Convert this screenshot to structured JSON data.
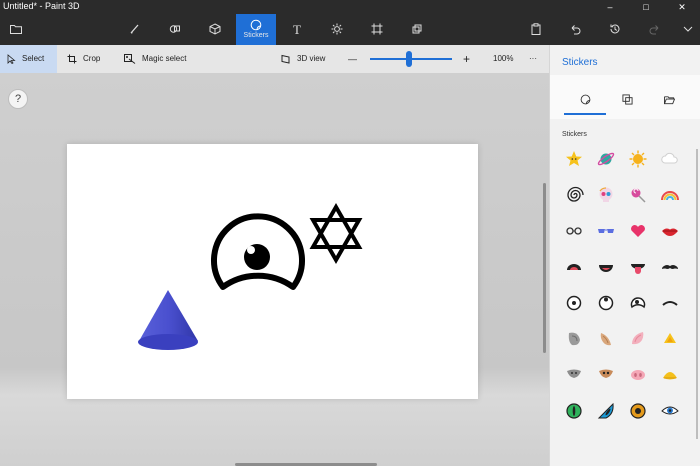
{
  "window": {
    "title": "Untitled* - Paint 3D",
    "controls": [
      "minimize",
      "maximize",
      "close"
    ]
  },
  "ribbon": {
    "tools": [
      {
        "name": "menu",
        "icon": "folder-icon"
      },
      {
        "name": "brushes",
        "icon": "brush-icon"
      },
      {
        "name": "2d-shapes",
        "icon": "2d-shapes-icon"
      },
      {
        "name": "3d-shapes",
        "icon": "cube-icon"
      },
      {
        "name": "stickers",
        "icon": "sticker-icon",
        "label": "Stickers",
        "active": true
      },
      {
        "name": "text",
        "icon": "text-icon"
      },
      {
        "name": "effects",
        "icon": "sun-icon"
      },
      {
        "name": "canvas",
        "icon": "canvas-icon"
      },
      {
        "name": "remix3d",
        "icon": "remix3d-icon"
      },
      {
        "name": "paste",
        "icon": "paste-icon"
      },
      {
        "name": "undo",
        "icon": "undo-icon"
      },
      {
        "name": "history",
        "icon": "history-icon"
      },
      {
        "name": "redo",
        "icon": "redo-icon"
      },
      {
        "name": "expand",
        "icon": "chevron-down-icon"
      }
    ],
    "accent": "#1f6fd6"
  },
  "toolbar": {
    "select_label": "Select",
    "crop_label": "Crop",
    "magic_select_label": "Magic select",
    "view3d_label": "3D view",
    "zoom_value": "100%",
    "zoom_minus": "—",
    "zoom_plus": "+",
    "more": "···"
  },
  "workspace": {
    "help": "?"
  },
  "panel": {
    "title": "Stickers",
    "section_label": "Stickers",
    "tabs": [
      {
        "name": "stickers",
        "icon": "sticker-icon",
        "active": true
      },
      {
        "name": "textures",
        "icon": "texture-icon"
      },
      {
        "name": "custom",
        "icon": "folder-open-icon"
      }
    ],
    "stickers": [
      [
        "star-face-sticker",
        "planet-sticker",
        "sun-face-sticker",
        "cloud-sticker"
      ],
      [
        "spiral-sticker",
        "skull-sticker",
        "lollipop-sticker",
        "rainbow-sticker"
      ],
      [
        "glasses-sticker",
        "sunglasses-sticker",
        "heart-sticker",
        "lips-sticker"
      ],
      [
        "open-mouth-sticker",
        "smile-mouth-sticker",
        "tongue-sticker",
        "mustache-sticker"
      ],
      [
        "eye-center-sticker",
        "eye-up-sticker",
        "eye-down-sticker",
        "eyebrow-sticker"
      ],
      [
        "ear-gray-sticker",
        "ear-tan-sticker",
        "ear-pink-sticker",
        "ear-yellow-sticker"
      ],
      [
        "nose-gray-sticker",
        "nose-tan-sticker",
        "nose-pig-sticker",
        "nose-beak-sticker"
      ],
      [
        "eye-green-sticker",
        "eye-teal-sticker",
        "eye-amber-sticker",
        "eye-blue-sticker"
      ]
    ]
  }
}
